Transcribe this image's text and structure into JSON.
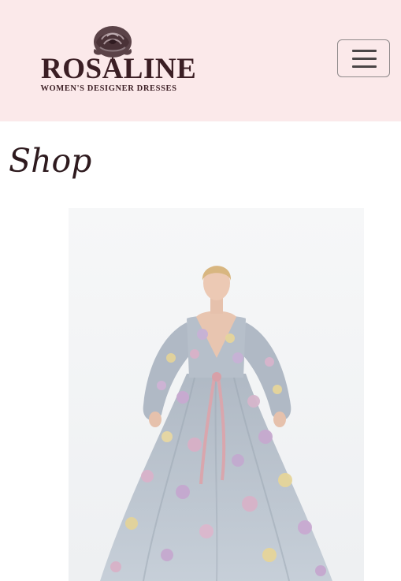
{
  "brand": {
    "name": "ROSALINE",
    "tagline": "WOMEN'S DESIGNER DRESSES",
    "logo_icon": "rose-icon"
  },
  "nav": {
    "toggle_icon": "hamburger-menu-icon",
    "toggle_aria": "Toggle navigation"
  },
  "page": {
    "title": "Shop"
  },
  "product": {
    "image_alt": "Model wearing a long-sleeved grey tulle gown with pastel 3D flower appliqués and a pink ribbon sash"
  },
  "colors": {
    "header_bg": "#fbe9ea",
    "brand_text": "#3b1e24",
    "title_text": "#2e1a1e"
  }
}
